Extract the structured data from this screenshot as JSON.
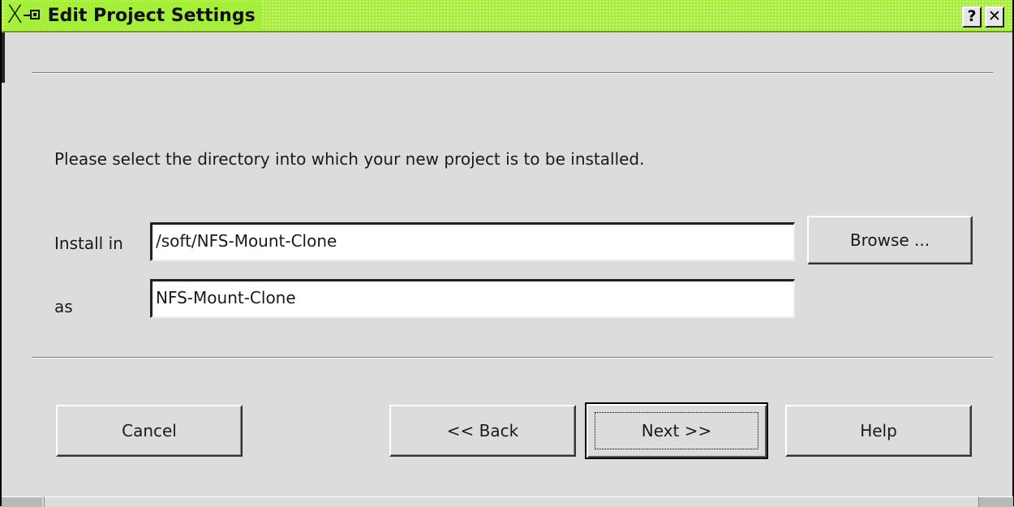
{
  "window": {
    "title": "Edit Project Settings",
    "help_button": "?",
    "close_button": "✕",
    "titlebar_color": "#a5ee3a"
  },
  "main": {
    "instruction": "Please select the directory into which your new project is to be installed.",
    "install_in_label": "Install in",
    "install_in_value": "/soft/NFS-Mount-Clone",
    "as_label": "as",
    "as_value": "NFS-Mount-Clone",
    "browse_label": "Browse ..."
  },
  "footer": {
    "cancel_label": "Cancel",
    "back_label": "<< Back",
    "next_label": "Next >>",
    "help_label": "Help"
  }
}
